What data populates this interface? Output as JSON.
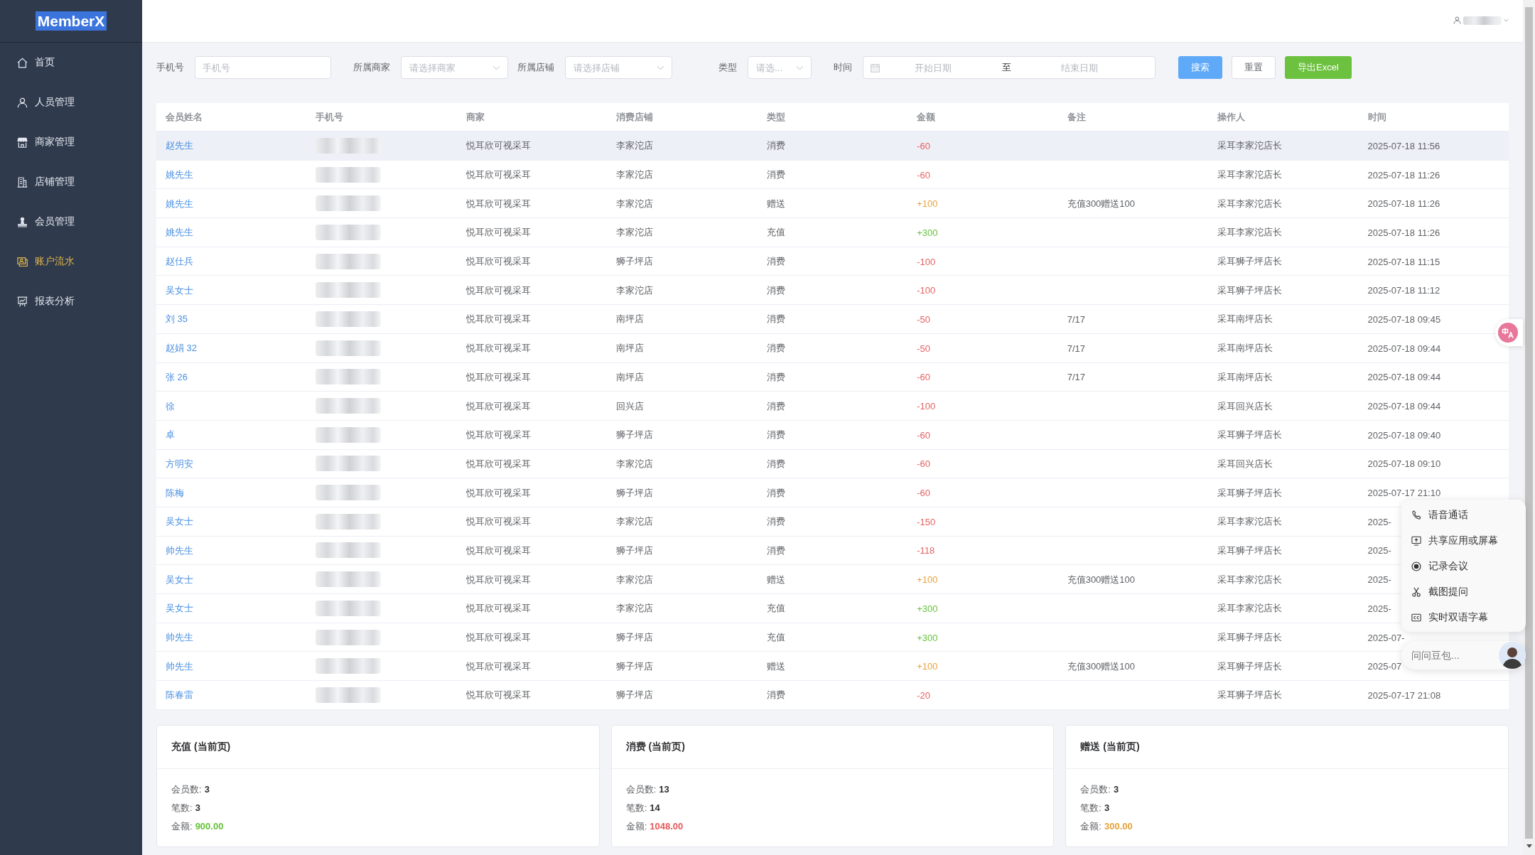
{
  "sidebar": {
    "logo": "MemberX",
    "items": [
      {
        "label": "首页",
        "selected": false
      },
      {
        "label": "人员管理",
        "selected": false
      },
      {
        "label": "商家管理",
        "selected": false
      },
      {
        "label": "店铺管理",
        "selected": false
      },
      {
        "label": "会员管理",
        "selected": false
      },
      {
        "label": "账户流水",
        "selected": true
      },
      {
        "label": "报表分析",
        "selected": false
      }
    ]
  },
  "filters": {
    "fields": [
      {
        "kind": "input",
        "label": "手机号",
        "placeholder": "手机号"
      },
      {
        "kind": "select",
        "label": "所属商家",
        "placeholder": "请选择商家"
      },
      {
        "kind": "select",
        "label": "所属店铺",
        "placeholder": "请选择店铺"
      },
      {
        "kind": "select",
        "label": "类型",
        "placeholder": "请选..."
      },
      {
        "kind": "daterange",
        "label": "时间",
        "start_placeholder": "开始日期",
        "separator": "至",
        "end_placeholder": "结束日期"
      }
    ],
    "buttons": [
      {
        "kind": "primary",
        "label": "搜索"
      },
      {
        "kind": "default",
        "label": "重置"
      },
      {
        "kind": "success",
        "label": "导出Excel"
      }
    ]
  },
  "table": {
    "columns": [
      "会员姓名",
      "手机号",
      "商家",
      "消费店铺",
      "类型",
      "金额",
      "备注",
      "操作人",
      "时间"
    ],
    "rows": [
      {
        "name": "赵先生",
        "phone": {
          "redacted": true
        },
        "merchant": "悦耳欣可视采耳",
        "store": "李家沱店",
        "type": "消费",
        "amount": "-60",
        "color": "#e66262",
        "operator": "采耳李家沱店长",
        "time": "2025-07-18 11:56",
        "hovered": true
      },
      {
        "name": "姚先生",
        "phone": {
          "redacted": true
        },
        "merchant": "悦耳欣可视采耳",
        "store": "李家沱店",
        "type": "消费",
        "amount": "-60",
        "color": "#e66262",
        "operator": "采耳李家沱店长",
        "time": "2025-07-18 11:26",
        "hovered": false
      },
      {
        "name": "姚先生",
        "phone": {
          "redacted": true
        },
        "merchant": "悦耳欣可视采耳",
        "store": "李家沱店",
        "type": "赠送",
        "amount": "+100",
        "color": "#e6a23c",
        "remark": "充值300赠送100",
        "operator": "采耳李家沱店长",
        "time": "2025-07-18 11:26",
        "hovered": false
      },
      {
        "name": "姚先生",
        "phone": {
          "redacted": true
        },
        "merchant": "悦耳欣可视采耳",
        "store": "李家沱店",
        "type": "充值",
        "amount": "+300",
        "color": "#67c23a",
        "operator": "采耳李家沱店长",
        "time": "2025-07-18 11:26",
        "hovered": false
      },
      {
        "name": "赵仕兵",
        "phone": {
          "redacted": true
        },
        "merchant": "悦耳欣可视采耳",
        "store": "狮子坪店",
        "type": "消费",
        "amount": "-100",
        "color": "#e66262",
        "operator": "采耳狮子坪店长",
        "time": "2025-07-18 11:15",
        "hovered": false
      },
      {
        "name": "吴女士",
        "phone": {
          "redacted": true
        },
        "merchant": "悦耳欣可视采耳",
        "store": "李家沱店",
        "type": "消费",
        "amount": "-100",
        "color": "#e66262",
        "operator": "采耳狮子坪店长",
        "time": "2025-07-18 11:12",
        "hovered": false
      },
      {
        "name": "刘 35",
        "phone": {
          "redacted": true
        },
        "merchant": "悦耳欣可视采耳",
        "store": "南坪店",
        "type": "消费",
        "amount": "-50",
        "color": "#e66262",
        "remark": "7/17",
        "operator": "采耳南坪店长",
        "time": "2025-07-18 09:45",
        "hovered": false
      },
      {
        "name": "赵娟 32",
        "phone": {
          "redacted": true
        },
        "merchant": "悦耳欣可视采耳",
        "store": "南坪店",
        "type": "消费",
        "amount": "-50",
        "color": "#e66262",
        "remark": "7/17",
        "operator": "采耳南坪店长",
        "time": "2025-07-18 09:44",
        "hovered": false
      },
      {
        "name": "张 26",
        "phone": {
          "redacted": true
        },
        "merchant": "悦耳欣可视采耳",
        "store": "南坪店",
        "type": "消费",
        "amount": "-60",
        "color": "#e66262",
        "remark": "7/17",
        "operator": "采耳南坪店长",
        "time": "2025-07-18 09:44",
        "hovered": false
      },
      {
        "name": "徐",
        "phone": {
          "redacted": true
        },
        "merchant": "悦耳欣可视采耳",
        "store": "回兴店",
        "type": "消费",
        "amount": "-100",
        "color": "#e66262",
        "operator": "采耳回兴店长",
        "time": "2025-07-18 09:44",
        "hovered": false
      },
      {
        "name": "卓",
        "phone": {
          "redacted": true
        },
        "merchant": "悦耳欣可视采耳",
        "store": "狮子坪店",
        "type": "消费",
        "amount": "-60",
        "color": "#e66262",
        "operator": "采耳狮子坪店长",
        "time": "2025-07-18 09:40",
        "hovered": false
      },
      {
        "name": "方明安",
        "phone": {
          "redacted": true
        },
        "merchant": "悦耳欣可视采耳",
        "store": "李家沱店",
        "type": "消费",
        "amount": "-60",
        "color": "#e66262",
        "operator": "采耳回兴店长",
        "time": "2025-07-18 09:10",
        "hovered": false
      },
      {
        "name": "陈梅",
        "phone": {
          "redacted": true
        },
        "merchant": "悦耳欣可视采耳",
        "store": "狮子坪店",
        "type": "消费",
        "amount": "-60",
        "color": "#e66262",
        "operator": "采耳狮子坪店长",
        "time": "2025-07-17 21:10",
        "hovered": false
      },
      {
        "name": "吴女士",
        "phone": {
          "redacted": true
        },
        "merchant": "悦耳欣可视采耳",
        "store": "李家沱店",
        "type": "消费",
        "amount": "-150",
        "color": "#e66262",
        "operator": "采耳李家沱店长",
        "time": "2025-",
        "hovered": false
      },
      {
        "name": "帅先生",
        "phone": {
          "redacted": true
        },
        "merchant": "悦耳欣可视采耳",
        "store": "狮子坪店",
        "type": "消费",
        "amount": "-118",
        "color": "#e66262",
        "operator": "采耳狮子坪店长",
        "time": "2025-",
        "hovered": false
      },
      {
        "name": "吴女士",
        "phone": {
          "redacted": true
        },
        "merchant": "悦耳欣可视采耳",
        "store": "李家沱店",
        "type": "赠送",
        "amount": "+100",
        "color": "#e6a23c",
        "remark": "充值300赠送100",
        "operator": "采耳李家沱店长",
        "time": "2025-",
        "hovered": false
      },
      {
        "name": "吴女士",
        "phone": {
          "redacted": true
        },
        "merchant": "悦耳欣可视采耳",
        "store": "李家沱店",
        "type": "充值",
        "amount": "+300",
        "color": "#67c23a",
        "operator": "采耳李家沱店长",
        "time": "2025-",
        "hovered": false
      },
      {
        "name": "帅先生",
        "phone": {
          "redacted": true
        },
        "merchant": "悦耳欣可视采耳",
        "store": "狮子坪店",
        "type": "充值",
        "amount": "+300",
        "color": "#67c23a",
        "operator": "采耳狮子坪店长",
        "time": "2025-07-",
        "hovered": false
      },
      {
        "name": "帅先生",
        "phone": {
          "redacted": true
        },
        "merchant": "悦耳欣可视采耳",
        "store": "狮子坪店",
        "type": "赠送",
        "amount": "+100",
        "color": "#e6a23c",
        "remark": "充值300赠送100",
        "operator": "采耳狮子坪店长",
        "time": "2025-07",
        "hovered": false
      },
      {
        "name": "陈春雷",
        "phone": {
          "redacted": true
        },
        "merchant": "悦耳欣可视采耳",
        "store": "狮子坪店",
        "type": "消费",
        "amount": "-20",
        "color": "#e66262",
        "operator": "采耳狮子坪店长",
        "time": "2025-07-17 21:08",
        "hovered": false
      }
    ]
  },
  "summary_cards": [
    {
      "title": "充值 (当前页)",
      "stats": [
        {
          "label": "会员数:",
          "value": "3"
        },
        {
          "label": "笔数:",
          "value": "3"
        },
        {
          "label": "金额:",
          "value": "900.00",
          "color": "#67c23a"
        }
      ]
    },
    {
      "title": "消费 (当前页)",
      "stats": [
        {
          "label": "会员数:",
          "value": "13"
        },
        {
          "label": "笔数:",
          "value": "14"
        },
        {
          "label": "金额:",
          "value": "1048.00",
          "color": "#e65a5a"
        }
      ]
    },
    {
      "title": "赠送 (当前页)",
      "stats": [
        {
          "label": "会员数:",
          "value": "3"
        },
        {
          "label": "笔数:",
          "value": "3"
        },
        {
          "label": "金额:",
          "value": "300.00",
          "color": "#e6a23c"
        }
      ]
    }
  ],
  "assistant_panel": {
    "menu_items": [
      "语音通话",
      "共享应用或屏幕",
      "记录会议",
      "截图提问",
      "实时双语字幕"
    ],
    "ask_field": {
      "placeholder": "问问豆包..."
    }
  }
}
